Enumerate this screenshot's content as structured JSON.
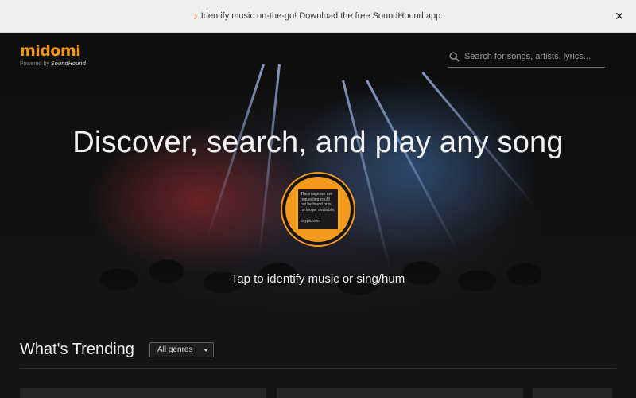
{
  "banner": {
    "message": "Identify music on-the-go! Download the free SoundHound app.",
    "note_icon": "music-note-icon",
    "close_icon": "close-icon"
  },
  "header": {
    "logo_text": "midomi",
    "logo_powered": "Powered by",
    "logo_brand": "SoundHound",
    "search_placeholder": "Search for songs, artists, lyrics..."
  },
  "hero": {
    "headline": "Discover, search, and play any song",
    "button_image_text": "The image we are requesting could not be found or is no longer available.",
    "button_image_url": "tinypic.com",
    "tap_label": "Tap to identify music or sing/hum"
  },
  "trending": {
    "title": "What's Trending",
    "genre_selected": "All genres"
  },
  "colors": {
    "accent": "#f39a1e",
    "background": "#141414",
    "banner": "#efefef"
  }
}
